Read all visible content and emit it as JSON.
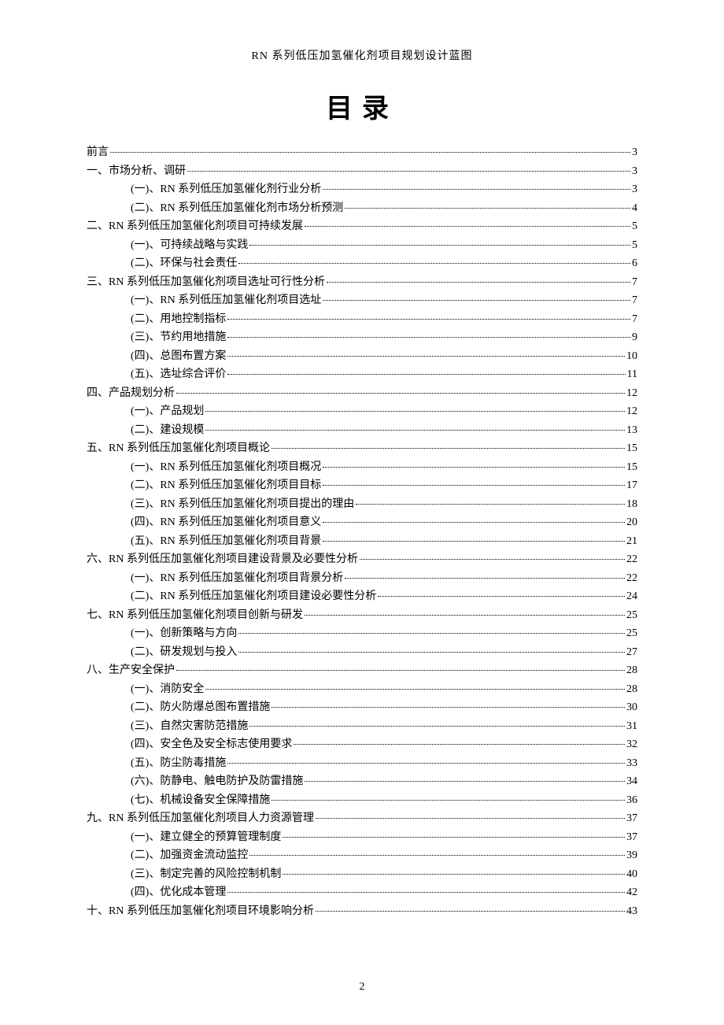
{
  "header": "RN 系列低压加氢催化剂项目规划设计蓝图",
  "title": "目录",
  "page_number": "2",
  "toc": [
    {
      "level": 0,
      "label": "前言",
      "page": "3"
    },
    {
      "level": 0,
      "label": "一、市场分析、调研",
      "page": "3"
    },
    {
      "level": 1,
      "label": "(一)、RN 系列低压加氢催化剂行业分析",
      "page": "3"
    },
    {
      "level": 1,
      "label": "(二)、RN 系列低压加氢催化剂市场分析预测",
      "page": "4"
    },
    {
      "level": 0,
      "label": "二、RN 系列低压加氢催化剂项目可持续发展",
      "page": "5"
    },
    {
      "level": 1,
      "label": "(一)、可持续战略与实践",
      "page": "5"
    },
    {
      "level": 1,
      "label": "(二)、环保与社会责任",
      "page": "6"
    },
    {
      "level": 0,
      "label": "三、RN 系列低压加氢催化剂项目选址可行性分析",
      "page": "7"
    },
    {
      "level": 1,
      "label": "(一)、RN 系列低压加氢催化剂项目选址",
      "page": "7"
    },
    {
      "level": 1,
      "label": "(二)、用地控制指标",
      "page": "7"
    },
    {
      "level": 1,
      "label": "(三)、节约用地措施",
      "page": "9"
    },
    {
      "level": 1,
      "label": "(四)、总图布置方案",
      "page": "10"
    },
    {
      "level": 1,
      "label": "(五)、选址综合评价",
      "page": "11"
    },
    {
      "level": 0,
      "label": "四、产品规划分析",
      "page": "12"
    },
    {
      "level": 1,
      "label": "(一)、产品规划",
      "page": "12"
    },
    {
      "level": 1,
      "label": "(二)、建设规模",
      "page": "13"
    },
    {
      "level": 0,
      "label": "五、RN 系列低压加氢催化剂项目概论",
      "page": "15"
    },
    {
      "level": 1,
      "label": "(一)、RN 系列低压加氢催化剂项目概况",
      "page": "15"
    },
    {
      "level": 1,
      "label": "(二)、RN 系列低压加氢催化剂项目目标",
      "page": "17"
    },
    {
      "level": 1,
      "label": "(三)、RN 系列低压加氢催化剂项目提出的理由",
      "page": "18"
    },
    {
      "level": 1,
      "label": "(四)、RN 系列低压加氢催化剂项目意义",
      "page": "20"
    },
    {
      "level": 1,
      "label": "(五)、RN 系列低压加氢催化剂项目背景",
      "page": "21"
    },
    {
      "level": 0,
      "label": "六、RN 系列低压加氢催化剂项目建设背景及必要性分析",
      "page": "22"
    },
    {
      "level": 1,
      "label": "(一)、RN 系列低压加氢催化剂项目背景分析",
      "page": "22"
    },
    {
      "level": 1,
      "label": "(二)、RN 系列低压加氢催化剂项目建设必要性分析",
      "page": "24"
    },
    {
      "level": 0,
      "label": "七、RN 系列低压加氢催化剂项目创新与研发",
      "page": "25"
    },
    {
      "level": 1,
      "label": "(一)、创新策略与方向",
      "page": "25"
    },
    {
      "level": 1,
      "label": "(二)、研发规划与投入",
      "page": "27"
    },
    {
      "level": 0,
      "label": "八、生产安全保护",
      "page": "28"
    },
    {
      "level": 1,
      "label": "(一)、消防安全",
      "page": "28"
    },
    {
      "level": 1,
      "label": "(二)、防火防爆总图布置措施",
      "page": "30"
    },
    {
      "level": 1,
      "label": "(三)、自然灾害防范措施",
      "page": "31"
    },
    {
      "level": 1,
      "label": "(四)、安全色及安全标志使用要求",
      "page": "32"
    },
    {
      "level": 1,
      "label": "(五)、防尘防毒措施",
      "page": "33"
    },
    {
      "level": 1,
      "label": "(六)、防静电、触电防护及防雷措施",
      "page": "34"
    },
    {
      "level": 1,
      "label": "(七)、机械设备安全保障措施",
      "page": "36"
    },
    {
      "level": 0,
      "label": "九、RN 系列低压加氢催化剂项目人力资源管理",
      "page": "37"
    },
    {
      "level": 1,
      "label": "(一)、建立健全的预算管理制度",
      "page": "37"
    },
    {
      "level": 1,
      "label": "(二)、加强资金流动监控",
      "page": "39"
    },
    {
      "level": 1,
      "label": "(三)、制定完善的风险控制机制",
      "page": "40"
    },
    {
      "level": 1,
      "label": "(四)、优化成本管理",
      "page": "42"
    },
    {
      "level": 0,
      "label": "十、RN 系列低压加氢催化剂项目环境影响分析",
      "page": "43"
    }
  ]
}
